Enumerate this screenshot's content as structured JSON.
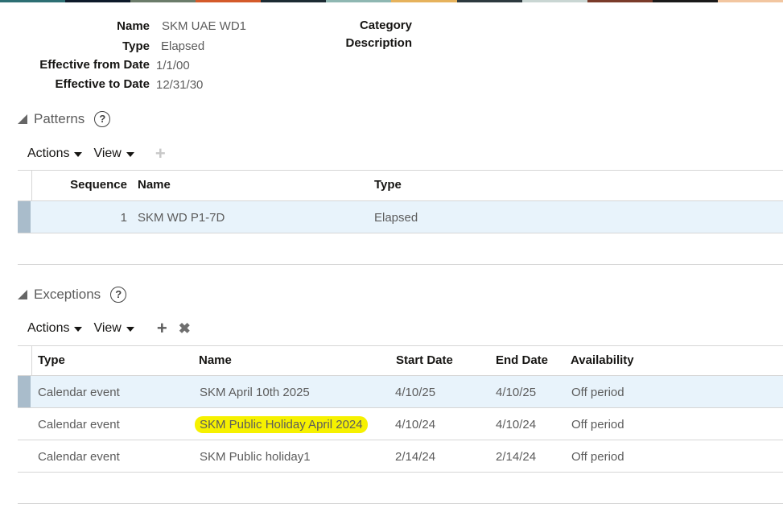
{
  "top_colors": [
    "#2d6f73",
    "#0d1a2a",
    "#6b7c6a",
    "#d45a2a",
    "#1c2b33",
    "#8fb7b2",
    "#e6b25c",
    "#2d3a3f",
    "#c9d6d3",
    "#7a3b2a",
    "#1a1a1a",
    "#f2c6a0"
  ],
  "header": {
    "name_label": "Name",
    "name_value": "SKM UAE WD1",
    "type_label": "Type",
    "type_value": "Elapsed",
    "from_label": "Effective from Date",
    "from_value": "1/1/00",
    "to_label": "Effective to Date",
    "to_value": "12/31/30",
    "category_label": "Category",
    "description_label": "Description"
  },
  "patterns": {
    "title": "Patterns",
    "help": "?",
    "toolbar": {
      "actions": "Actions",
      "view": "View",
      "add": "+"
    },
    "columns": [
      "Sequence",
      "Name",
      "Type"
    ],
    "rows": [
      {
        "sequence": "1",
        "name": "SKM WD P1-7D",
        "type": "Elapsed"
      }
    ]
  },
  "exceptions": {
    "title": "Exceptions",
    "help": "?",
    "toolbar": {
      "actions": "Actions",
      "view": "View",
      "add": "+",
      "delete": "✖"
    },
    "columns": [
      "Type",
      "Name",
      "Start Date",
      "End Date",
      "Availability"
    ],
    "rows": [
      {
        "type": "Calendar event",
        "name": "SKM April 10th 2025",
        "start": "4/10/25",
        "end": "4/10/25",
        "availability": "Off period"
      },
      {
        "type": "Calendar event",
        "name": "SKM Public Holiday April 2024",
        "start": "4/10/24",
        "end": "4/10/24",
        "availability": "Off period"
      },
      {
        "type": "Calendar event",
        "name": "SKM Public holiday1",
        "start": "2/14/24",
        "end": "2/14/24",
        "availability": "Off period"
      }
    ]
  }
}
